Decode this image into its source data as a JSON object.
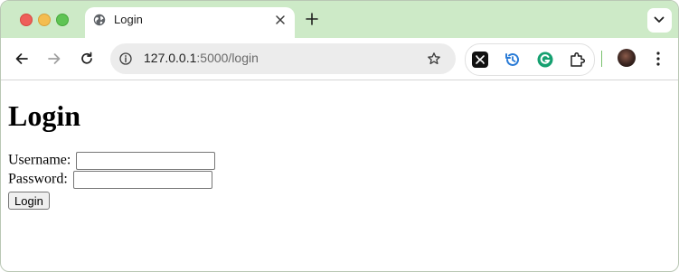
{
  "browser": {
    "tab": {
      "title": "Login"
    },
    "address_bar": {
      "url_host": "127.0.0.1",
      "url_rest": ":5000/login"
    }
  },
  "page": {
    "heading": "Login",
    "form": {
      "username_label": "Username:",
      "username_value": "",
      "password_label": "Password:",
      "password_value": "",
      "submit_label": "Login"
    }
  },
  "colors": {
    "tabstrip_bg": "#cdeac7",
    "omnibox_bg": "#ececec",
    "close_red": "#ee5f5a",
    "minimize_yellow": "#f4bd4f",
    "zoom_green": "#5fc454"
  },
  "icons": {
    "tab_favicon": "globe-icon",
    "tab_close": "close-icon",
    "new_tab": "plus-icon",
    "tab_search": "chevron-down-icon",
    "back": "arrow-left-icon",
    "forward": "arrow-right-icon",
    "reload": "reload-icon",
    "site_info": "info-icon",
    "bookmark": "star-icon",
    "extensions": [
      "scissors-app-icon",
      "history-icon",
      "grammarly-icon",
      "puzzle-icon"
    ],
    "profile": "avatar",
    "menu": "kebab-menu-icon"
  }
}
